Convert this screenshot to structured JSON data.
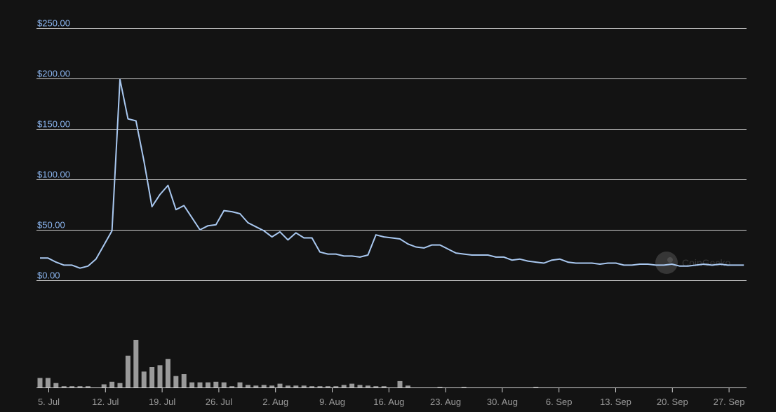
{
  "colors": {
    "background": "#131313",
    "price_line": "#a9c8f0",
    "grid": "#d0d0d0",
    "y_label": "#8ab4ee",
    "x_label": "#9a9a9a",
    "volume_bar": "#9a9a9a"
  },
  "watermark": {
    "text": "CoinGecko",
    "icon": "gecko-logo-icon"
  },
  "chart_data": {
    "type": "line",
    "title": "",
    "xlabel": "",
    "ylabel": "",
    "grid": true,
    "legend": "none",
    "ylim": [
      0,
      250
    ],
    "y_ticks": [
      "$250.00",
      "$200.00",
      "$150.00",
      "$100.00",
      "$50.00",
      "$0.00"
    ],
    "x_ticks": [
      "5. Jul",
      "12. Jul",
      "19. Jul",
      "26. Jul",
      "2. Aug",
      "9. Aug",
      "16. Aug",
      "23. Aug",
      "30. Aug",
      "6. Sep",
      "13. Sep",
      "20. Sep",
      "27. Sep"
    ],
    "x_start": "2020-07-04",
    "series": [
      {
        "type": "line",
        "values": [
          22,
          22,
          18,
          15,
          15,
          12,
          14,
          21,
          35,
          49,
          199,
          160,
          158,
          118,
          73,
          85,
          94,
          70,
          74,
          62,
          50,
          54,
          55,
          69,
          68,
          66,
          57,
          53,
          49,
          43,
          48,
          40,
          47,
          42,
          42,
          28,
          26,
          26,
          24,
          24,
          23,
          25,
          45,
          43,
          42,
          41,
          36,
          33,
          32,
          35,
          35,
          31,
          27,
          26,
          25,
          25,
          25,
          23,
          23,
          20,
          21,
          19,
          18,
          17,
          20,
          21,
          18,
          17,
          17,
          17,
          16,
          17,
          17,
          15,
          15,
          16,
          16,
          15,
          15,
          16,
          14,
          14,
          15,
          16,
          15,
          16,
          15,
          15,
          15
        ]
      },
      {
        "type": "volume",
        "values": [
          15,
          15,
          7,
          2,
          2,
          2,
          2,
          0,
          5,
          9,
          7,
          50,
          75,
          25,
          32,
          35,
          45,
          18,
          21,
          8,
          8,
          8,
          9,
          8,
          2,
          8,
          4,
          3,
          4,
          3,
          6,
          3,
          3,
          3,
          2,
          2,
          2,
          2,
          4,
          6,
          4,
          3,
          2,
          2,
          0,
          10,
          3,
          0,
          0,
          0,
          1,
          0,
          0,
          1,
          0,
          0,
          0,
          0,
          0,
          0,
          0,
          0,
          1,
          0,
          0,
          0,
          0,
          0,
          0,
          0,
          0,
          0,
          0,
          0,
          0,
          0,
          0,
          0,
          0,
          0,
          0,
          0,
          0,
          0,
          0,
          0,
          0,
          0,
          0
        ]
      }
    ]
  }
}
